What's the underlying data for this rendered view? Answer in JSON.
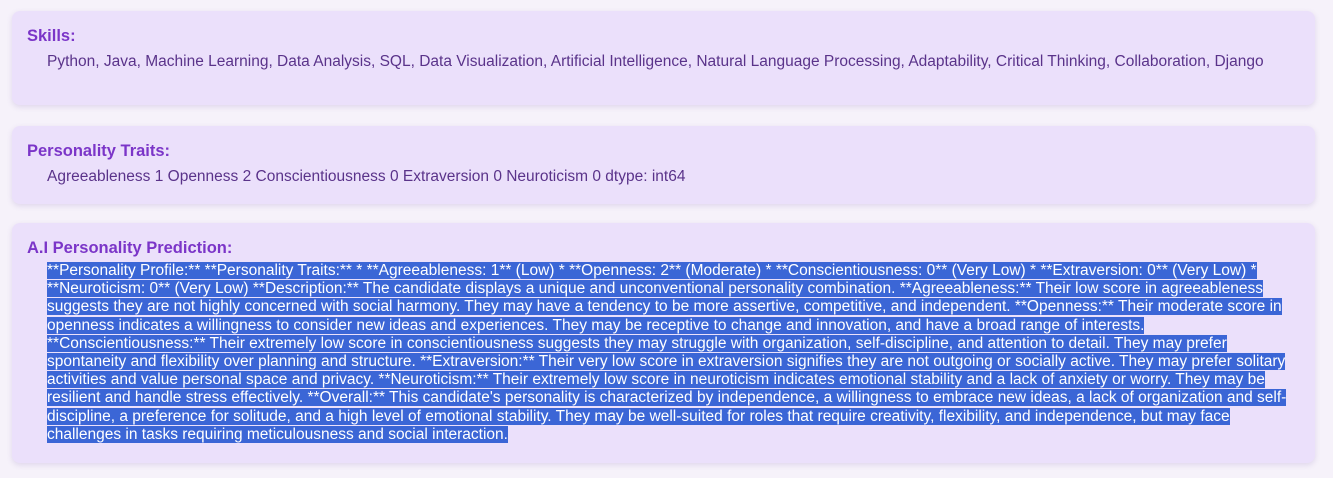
{
  "skills": {
    "title": "Skills:",
    "text": "Python, Java, Machine Learning, Data Analysis, SQL, Data Visualization, Artificial Intelligence, Natural Language Processing, Adaptability, Critical Thinking, Collaboration, Django"
  },
  "traits": {
    "title": "Personality Traits:",
    "text": "Agreeableness 1 Openness 2 Conscientiousness 0 Extraversion 0 Neuroticism 0 dtype: int64"
  },
  "prediction": {
    "title": "A.I Personality Prediction:",
    "text": "**Personality Profile:** **Personality Traits:** * **Agreeableness: 1** (Low) * **Openness: 2** (Moderate) * **Conscientiousness: 0** (Very Low) * **Extraversion: 0** (Very Low) * **Neuroticism: 0** (Very Low) **Description:** The candidate displays a unique and unconventional personality combination. **Agreeableness:** Their low score in agreeableness suggests they are not highly concerned with social harmony. They may have a tendency to be more assertive, competitive, and independent. **Openness:** Their moderate score in openness indicates a willingness to consider new ideas and experiences. They may be receptive to change and innovation, and have a broad range of interests. **Conscientiousness:** Their extremely low score in conscientiousness suggests they may struggle with organization, self-discipline, and attention to detail. They may prefer spontaneity and flexibility over planning and structure. **Extraversion:** Their very low score in extraversion signifies they are not outgoing or socially active. They may prefer solitary activities and value personal space and privacy. **Neuroticism:** Their extremely low score in neuroticism indicates emotional stability and a lack of anxiety or worry. They may be resilient and handle stress effectively. **Overall:** This candidate's personality is characterized by independence, a willingness to embrace new ideas, a lack of organization and self-discipline, a preference for solitude, and a high level of emotional stability. They may be well-suited for roles that require creativity, flexibility, and independence, but may face challenges in tasks requiring meticulousness and social interaction."
  }
}
